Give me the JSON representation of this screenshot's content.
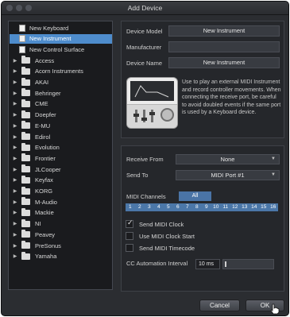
{
  "window": {
    "title": "Add Device"
  },
  "device_list": [
    {
      "label": "New Keyboard",
      "type": "doc",
      "selected": false
    },
    {
      "label": "New Instrument",
      "type": "doc",
      "selected": true
    },
    {
      "label": "New Control Surface",
      "type": "doc",
      "selected": false
    },
    {
      "label": "Access",
      "type": "folder"
    },
    {
      "label": "Acorn Instruments",
      "type": "folder"
    },
    {
      "label": "AKAI",
      "type": "folder"
    },
    {
      "label": "Behringer",
      "type": "folder"
    },
    {
      "label": "CME",
      "type": "folder"
    },
    {
      "label": "Doepfer",
      "type": "folder"
    },
    {
      "label": "E-MU",
      "type": "folder"
    },
    {
      "label": "Edirol",
      "type": "folder"
    },
    {
      "label": "Evolution",
      "type": "folder"
    },
    {
      "label": "Frontier",
      "type": "folder"
    },
    {
      "label": "JLCooper",
      "type": "folder"
    },
    {
      "label": "Keyfax",
      "type": "folder"
    },
    {
      "label": "KORG",
      "type": "folder"
    },
    {
      "label": "M-Audio",
      "type": "folder"
    },
    {
      "label": "Mackie",
      "type": "folder"
    },
    {
      "label": "NI",
      "type": "folder"
    },
    {
      "label": "Peavey",
      "type": "folder"
    },
    {
      "label": "PreSonus",
      "type": "folder"
    },
    {
      "label": "Yamaha",
      "type": "folder"
    }
  ],
  "form": {
    "device_model_label": "Device Model",
    "device_model_value": "New Instrument",
    "manufacturer_label": "Manufacturer",
    "manufacturer_value": "",
    "device_name_label": "Device Name",
    "device_name_value": "New Instrument",
    "description": "Use to play an external MIDI Instrument and record controller movements. When connecting the receive port, be careful to avoid doubled events if the same port is used by a Keyboard device."
  },
  "midi": {
    "receive_from_label": "Receive From",
    "receive_from_value": "None",
    "send_to_label": "Send To",
    "send_to_value": "MIDI Port #1",
    "channels_label": "MIDI Channels",
    "all_label": "All",
    "channels": [
      "1",
      "2",
      "3",
      "4",
      "5",
      "6",
      "7",
      "8",
      "9",
      "10",
      "11",
      "12",
      "13",
      "14",
      "15",
      "16"
    ],
    "send_clock_label": "Send MIDI Clock",
    "send_clock_checked": true,
    "clock_start_label": "Use MIDI Clock Start",
    "clock_start_checked": false,
    "timecode_label": "Send MIDI Timecode",
    "timecode_checked": false,
    "cc_interval_label": "CC Automation Interval",
    "cc_interval_value": "10 ms"
  },
  "footer": {
    "cancel_label": "Cancel",
    "ok_label": "OK"
  },
  "colors": {
    "selection": "#4e8ccc",
    "channel_button": "#4b77a8",
    "panel": "#25272b"
  }
}
